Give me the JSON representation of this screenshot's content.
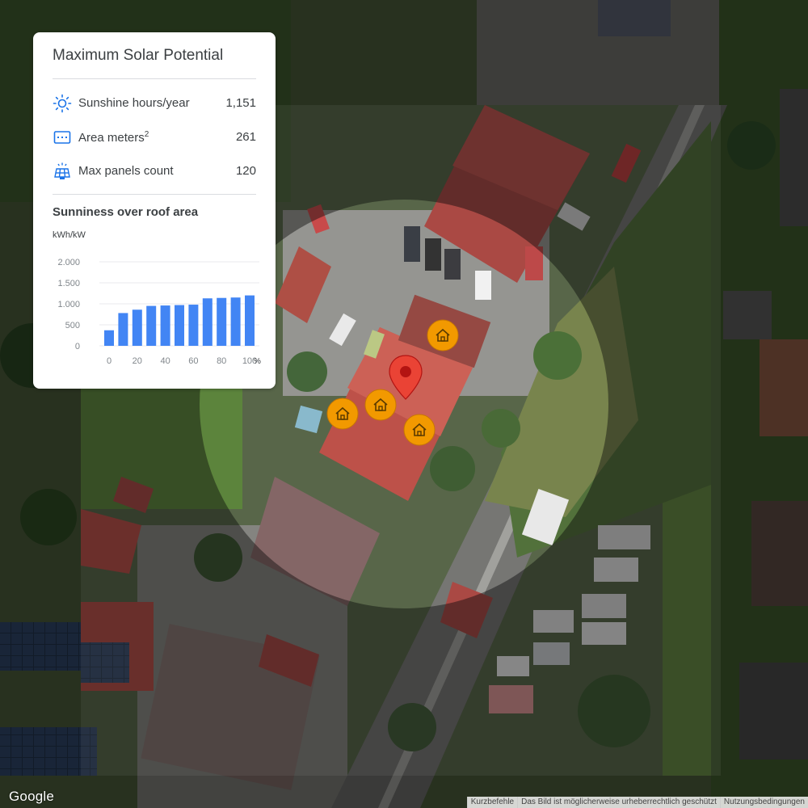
{
  "card": {
    "title": "Maximum Solar Potential",
    "stats": [
      {
        "label": "Sunshine hours/year",
        "value": "1,151",
        "icon": "sun-icon"
      },
      {
        "label": "Area meters",
        "superscript": "2",
        "value": "261",
        "icon": "area-icon"
      },
      {
        "label": "Max panels count",
        "value": "120",
        "icon": "solar-panel-icon"
      }
    ],
    "section_title": "Sunniness over roof area",
    "unit": "kWh/kW"
  },
  "chart_data": {
    "type": "bar",
    "title": "Sunniness over roof area",
    "ylabel": "kWh/kW",
    "x_unit": "%",
    "x": [
      0,
      10,
      20,
      30,
      40,
      50,
      60,
      70,
      80,
      90,
      100
    ],
    "values": [
      370,
      780,
      860,
      950,
      960,
      970,
      980,
      1130,
      1140,
      1150,
      1200
    ],
    "ylim": [
      0,
      2000
    ],
    "yticks": [
      "0",
      "500",
      "1.000",
      "1.500",
      "2.000"
    ],
    "ytick_values": [
      0,
      500,
      1000,
      1500,
      2000
    ],
    "xticks": [
      "0",
      "20",
      "40",
      "60",
      "80",
      "100"
    ],
    "xtick_values": [
      0,
      20,
      40,
      60,
      80,
      100
    ],
    "bar_color": "#4285f4",
    "grid": true
  },
  "map": {
    "marker_color": "#ea4335",
    "house_marker_color": "#f29900",
    "house_markers": 4
  },
  "footer": {
    "logo": "Google",
    "links": [
      "Kurzbefehle",
      "Das Bild ist möglicherweise urheberrechtlich geschützt",
      "Nutzungsbedingungen"
    ]
  }
}
